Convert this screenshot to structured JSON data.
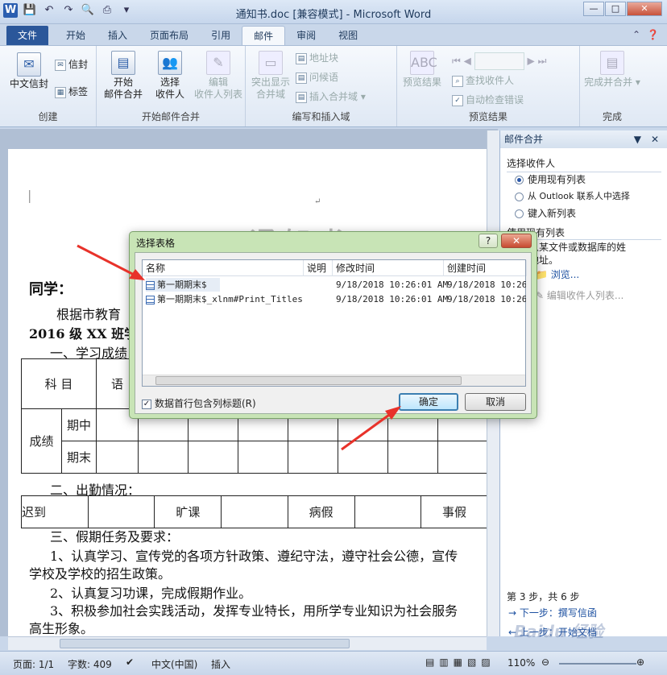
{
  "app": {
    "title": "通知书.doc [兼容模式] - Microsoft Word",
    "logo": "W"
  },
  "tabs": {
    "file": "文件",
    "items": [
      "开始",
      "插入",
      "页面布局",
      "引用",
      "邮件",
      "审阅",
      "视图"
    ],
    "active": "邮件"
  },
  "ribbon": {
    "create": {
      "label": "创建",
      "chinese_envelope": "中文信封",
      "envelope": "信封",
      "labels": "标签"
    },
    "start_merge": {
      "label": "开始邮件合并",
      "start": "开始",
      "start2": "邮件合并",
      "select": "选择",
      "select2": "收件人",
      "edit": "编辑",
      "edit2": "收件人列表"
    },
    "write_insert": {
      "label": "编写和插入域",
      "highlight": "突出显示",
      "highlight2": "合并域",
      "address": "地址块",
      "greeting": "问候语",
      "insert_field": "插入合并域"
    },
    "preview": {
      "label": "预览结果",
      "preview_btn": "预览结果",
      "find": "查找收件人",
      "auto_check": "自动检查错误"
    },
    "finish": {
      "label": "完成",
      "merge": "完成并合并"
    }
  },
  "panel": {
    "title": "邮件合并",
    "section_select": "选择收件人",
    "opt_existing": "使用现有列表",
    "opt_outlook": "从 Outlook 联系人中选择",
    "opt_new": "键入新列表",
    "section_use": "使用现有列表",
    "desc1": "从某文件或数据库的姓",
    "desc2": "地址。",
    "browse": "浏览...",
    "edit_list": "编辑收件人列表...",
    "step": "第 3 步，共 6 步",
    "next": "下一步：撰写信函",
    "prev": "上一步：开始文档"
  },
  "document": {
    "title": "通 知 书",
    "greeting": "同学：",
    "line1": "根据市教育",
    "line2": "2016 级 XX 班学",
    "sec1": "一、学习成绩",
    "tbl_subject": "科 目",
    "tbl_yu": "语",
    "tbl_score": "成绩",
    "tbl_mid": "期中",
    "tbl_final": "期末",
    "sec2": "二、出勤情况：",
    "att_late": "迟到",
    "att_absent": "旷课",
    "att_sick": "病假",
    "att_leave": "事假",
    "sec3": "三、假期任务及要求：",
    "task1": "1、认真学习、宣传党的各项方针政策、遵纪守法，遵守社会公德，宣传",
    "task1b": "学校及学校的招生政策。",
    "task2": "2、认真复习功课，完成假期作业。",
    "task3": "3、积极参加社会实践活动，发挥专业特长，用所学专业知识为社会服务",
    "task3b": "高生形象。"
  },
  "dialog": {
    "title": "选择表格",
    "help": "?",
    "close": "✕",
    "cols": {
      "name": "名称",
      "desc": "说明",
      "modified": "修改时间",
      "created": "创建时间"
    },
    "rows": [
      {
        "name": "第一期期末$",
        "desc": "",
        "modified": "9/18/2018 10:26:01 AM",
        "created": "9/18/2018 10:26:"
      },
      {
        "name": "第一期期末$_xlnm#Print_Titles",
        "desc": "",
        "modified": "9/18/2018 10:26:01 AM",
        "created": "9/18/2018 10:26:"
      }
    ],
    "checkbox": "数据首行包含列标题(R)",
    "ok": "确定",
    "cancel": "取消"
  },
  "status": {
    "page": "页面: 1/1",
    "words": "字数: 409",
    "lang": "中文(中国)",
    "mode": "插入",
    "zoom": "110%"
  },
  "watermark": "Baidu 经验"
}
